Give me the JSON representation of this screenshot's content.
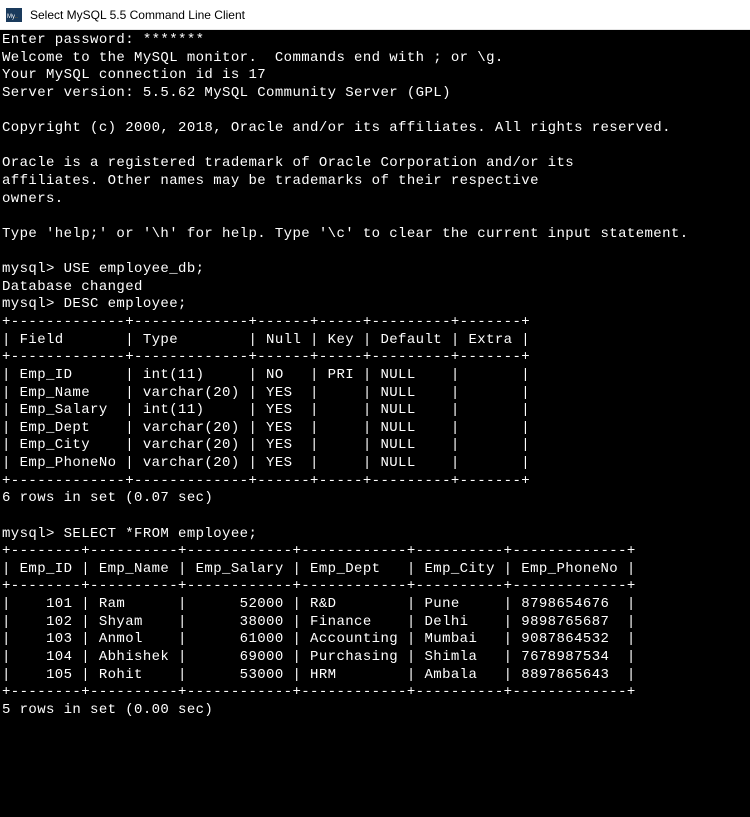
{
  "titlebar": {
    "icon_alt": "mysql-icon",
    "title": "Select MySQL 5.5 Command Line Client"
  },
  "lines": {
    "password_prompt": "Enter password: *******",
    "welcome": "Welcome to the MySQL monitor.  Commands end with ; or \\g.",
    "conn_id": "Your MySQL connection id is 17",
    "server_ver": "Server version: 5.5.62 MySQL Community Server (GPL)",
    "copyright": "Copyright (c) 2000, 2018, Oracle and/or its affiliates. All rights reserved.",
    "trademark1": "Oracle is a registered trademark of Oracle Corporation and/or its",
    "trademark2": "affiliates. Other names may be trademarks of their respective",
    "trademark3": "owners.",
    "help": "Type 'help;' or '\\h' for help. Type '\\c' to clear the current input statement.",
    "prompt1": "mysql> USE employee_db;",
    "db_changed": "Database changed",
    "prompt2": "mysql> DESC employee;",
    "desc_sep": "+-------------+-------------+------+-----+---------+-------+",
    "desc_hdr": "| Field       | Type        | Null | Key | Default | Extra |",
    "desc_r1": "| Emp_ID      | int(11)     | NO   | PRI | NULL    |       |",
    "desc_r2": "| Emp_Name    | varchar(20) | YES  |     | NULL    |       |",
    "desc_r3": "| Emp_Salary  | int(11)     | YES  |     | NULL    |       |",
    "desc_r4": "| Emp_Dept    | varchar(20) | YES  |     | NULL    |       |",
    "desc_r5": "| Emp_City    | varchar(20) | YES  |     | NULL    |       |",
    "desc_r6": "| Emp_PhoneNo | varchar(20) | YES  |     | NULL    |       |",
    "desc_count": "6 rows in set (0.07 sec)",
    "prompt3": "mysql> SELECT *FROM employee;",
    "sel_sep": "+--------+----------+------------+------------+----------+-------------+",
    "sel_hdr": "| Emp_ID | Emp_Name | Emp_Salary | Emp_Dept   | Emp_City | Emp_PhoneNo |",
    "sel_r1": "|    101 | Ram      |      52000 | R&D        | Pune     | 8798654676  |",
    "sel_r2": "|    102 | Shyam    |      38000 | Finance    | Delhi    | 9898765687  |",
    "sel_r3": "|    103 | Anmol    |      61000 | Accounting | Mumbai   | 9087864532  |",
    "sel_r4": "|    104 | Abhishek |      69000 | Purchasing | Shimla   | 7678987534  |",
    "sel_r5": "|    105 | Rohit    |      53000 | HRM        | Ambala   | 8897865643  |",
    "sel_count": "5 rows in set (0.00 sec)"
  }
}
